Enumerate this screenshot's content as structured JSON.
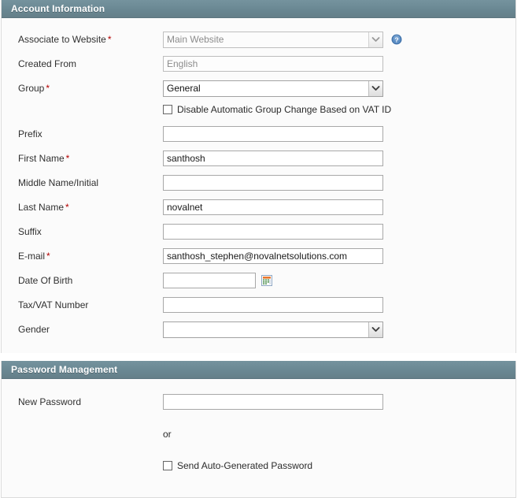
{
  "sections": [
    {
      "title": "Account Information",
      "fields": {
        "associate_website": {
          "label": "Associate to Website",
          "required": true,
          "value": "Main Website",
          "disabled": true,
          "help_icon": "help-question-icon"
        },
        "created_from": {
          "label": "Created From",
          "required": false,
          "value": "English",
          "disabled": true
        },
        "group": {
          "label": "Group",
          "required": true,
          "value": "General",
          "disabled": false
        },
        "disable_auto_group": {
          "label": "Disable Automatic Group Change Based on VAT ID",
          "checked": false
        },
        "prefix": {
          "label": "Prefix",
          "required": false,
          "value": "",
          "placeholder": ""
        },
        "first_name": {
          "label": "First Name",
          "required": true,
          "value": "santhosh",
          "placeholder": ""
        },
        "middle_name": {
          "label": "Middle Name/Initial",
          "required": false,
          "value": "",
          "placeholder": ""
        },
        "last_name": {
          "label": "Last Name",
          "required": true,
          "value": "novalnet",
          "placeholder": ""
        },
        "suffix": {
          "label": "Suffix",
          "required": false,
          "value": "",
          "placeholder": ""
        },
        "email": {
          "label": "E-mail",
          "required": true,
          "value": "santhosh_stephen@novalnetsolutions.com",
          "placeholder": ""
        },
        "date_of_birth": {
          "label": "Date Of Birth",
          "required": false,
          "value": "",
          "placeholder": "",
          "calendar_icon": "calendar-icon"
        },
        "tax_vat_number": {
          "label": "Tax/VAT Number",
          "required": false,
          "value": "",
          "placeholder": ""
        },
        "gender": {
          "label": "Gender",
          "required": false,
          "value": "",
          "disabled": false
        }
      }
    },
    {
      "title": "Password Management",
      "fields": {
        "new_password": {
          "label": "New Password",
          "required": false,
          "value": "",
          "placeholder": ""
        },
        "or_separator": "or",
        "send_auto_generated": {
          "label": "Send Auto-Generated Password",
          "checked": false
        }
      }
    }
  ],
  "colors": {
    "panel_header_bg": "#6a8893",
    "panel_header_text": "#ffffff",
    "panel_body_bg": "#fbfbfb",
    "required_asterisk": "#b30000",
    "label_text": "#303030",
    "input_border": "#a8a8a8",
    "disabled_text": "#8c8c8c",
    "help_icon_blue": "#4a7ebb",
    "calendar_icon_orange": "#e8762c"
  }
}
